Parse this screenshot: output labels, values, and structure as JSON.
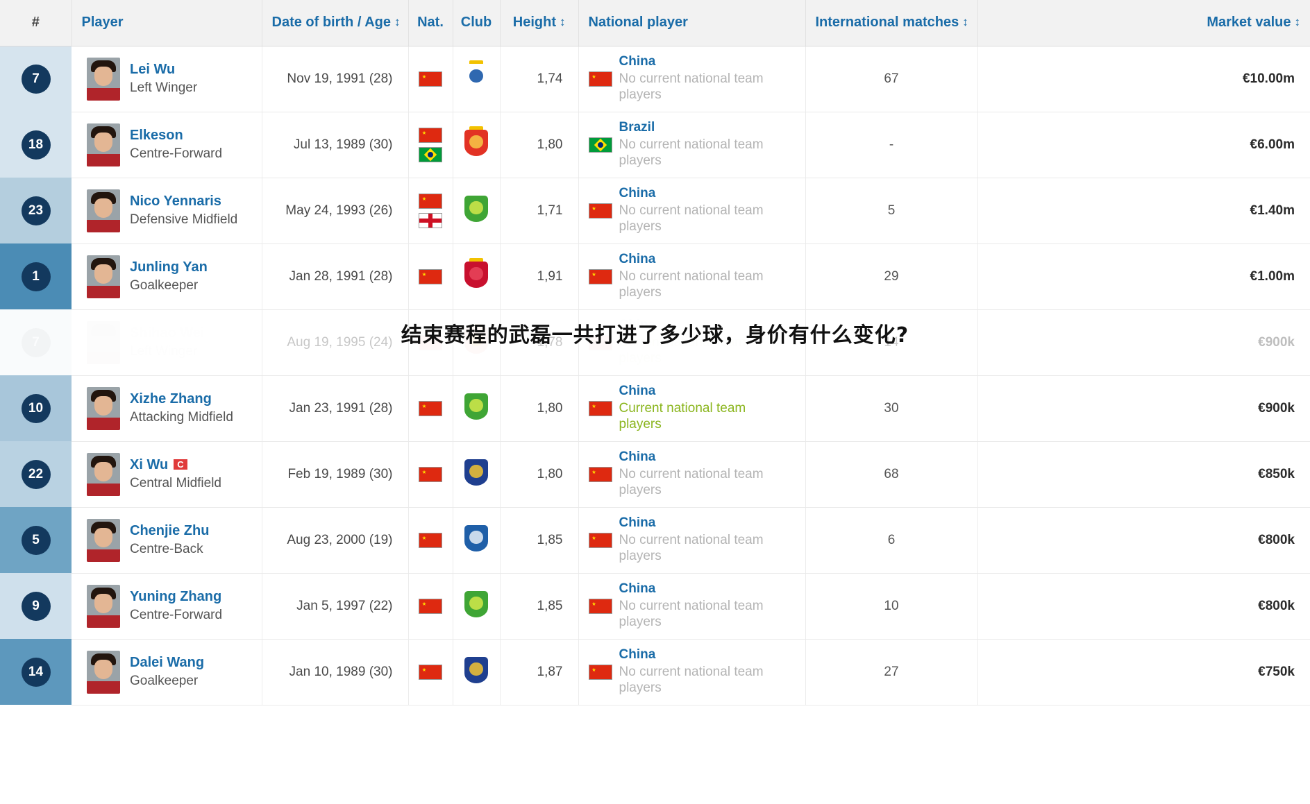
{
  "table": {
    "columns": [
      {
        "key": "rank",
        "label": "#",
        "sortable": false
      },
      {
        "key": "player",
        "label": "Player",
        "sortable": false
      },
      {
        "key": "dob",
        "label": "Date of birth / Age",
        "sortable": true,
        "sort_icon": "sort-updown-icon"
      },
      {
        "key": "nat",
        "label": "Nat.",
        "sortable": false
      },
      {
        "key": "club",
        "label": "Club",
        "sortable": false
      },
      {
        "key": "height",
        "label": "Height",
        "sortable": true,
        "sort_icon": "sort-updown-icon"
      },
      {
        "key": "natpl",
        "label": "National player",
        "sortable": false
      },
      {
        "key": "intl",
        "label": "International matches",
        "sortable": true,
        "sort_icon": "sort-updown-icon"
      },
      {
        "key": "mv",
        "label": "Market value",
        "sortable": true,
        "sort_icon": "sort-updown-icon"
      }
    ],
    "sort_glyph": "↕",
    "rows": [
      {
        "rank": "7",
        "name": "Lei Wu",
        "position": "Left Winger",
        "captain": false,
        "dob": "Nov 19, 1991 (28)",
        "nationalities": [
          "china",
          "none"
        ],
        "club": "espanyol",
        "height": "1,74",
        "nat_country": "China",
        "nat_status": "No current national team players",
        "nat_current": false,
        "intl": "67",
        "market_value": "€10.00m",
        "rank_bg": "#d6e4ee",
        "faded": false
      },
      {
        "rank": "18",
        "name": "Elkeson",
        "position": "Centre-Forward",
        "captain": false,
        "dob": "Jul 13, 1989 (30)",
        "nationalities": [
          "china",
          "brazil"
        ],
        "club": "guangzhou-evergrande",
        "height": "1,80",
        "nat_country": "Brazil",
        "nat_status": "No current national team players",
        "nat_current": false,
        "intl": "-",
        "market_value": "€6.00m",
        "rank_bg": "#d6e4ee",
        "faded": false
      },
      {
        "rank": "23",
        "name": "Nico Yennaris",
        "position": "Defensive Midfield",
        "captain": false,
        "dob": "May 24, 1993 (26)",
        "nationalities": [
          "china",
          "england"
        ],
        "club": "beijing-guoan",
        "height": "1,71",
        "nat_country": "China",
        "nat_status": "No current national team players",
        "nat_current": false,
        "intl": "5",
        "market_value": "€1.40m",
        "rank_bg": "#b4cede",
        "faded": false
      },
      {
        "rank": "1",
        "name": "Junling Yan",
        "position": "Goalkeeper",
        "captain": false,
        "dob": "Jan 28, 1991 (28)",
        "nationalities": [
          "china",
          "none"
        ],
        "club": "shanghai-sipg",
        "height": "1,91",
        "nat_country": "China",
        "nat_status": "No current national team players",
        "nat_current": false,
        "intl": "29",
        "market_value": "€1.00m",
        "rank_bg": "#4b8cb5",
        "faded": false
      },
      {
        "rank": "7",
        "name": "Shihao Wei",
        "position": "Left Winger",
        "captain": false,
        "dob": "Aug 19, 1995 (24)",
        "nationalities": [
          "china",
          "none"
        ],
        "club": "guangzhou-evergrande",
        "height": "1,78",
        "nat_country": "China",
        "nat_status": "Current national team players",
        "nat_current": true,
        "intl": "14",
        "market_value": "€900k",
        "rank_bg": "#eef3f7",
        "faded": true
      },
      {
        "rank": "10",
        "name": "Xizhe Zhang",
        "position": "Attacking Midfield",
        "captain": false,
        "dob": "Jan 23, 1991 (28)",
        "nationalities": [
          "china",
          "none"
        ],
        "club": "beijing-guoan",
        "height": "1,80",
        "nat_country": "China",
        "nat_status": "Current national team players",
        "nat_current": true,
        "intl": "30",
        "market_value": "€900k",
        "rank_bg": "#a8c6da",
        "faded": false
      },
      {
        "rank": "22",
        "name": "Xi Wu",
        "position": "Central Midfield",
        "captain": true,
        "dob": "Feb 19, 1989 (30)",
        "nationalities": [
          "china",
          "none"
        ],
        "club": "shandong-luneng",
        "height": "1,80",
        "nat_country": "China",
        "nat_status": "No current national team players",
        "nat_current": false,
        "intl": "68",
        "market_value": "€850k",
        "rank_bg": "#b9d2e2",
        "faded": false
      },
      {
        "rank": "5",
        "name": "Chenjie Zhu",
        "position": "Centre-Back",
        "captain": false,
        "dob": "Aug 23, 2000 (19)",
        "nationalities": [
          "china",
          "none"
        ],
        "club": "shanghai-shenhua",
        "height": "1,85",
        "nat_country": "China",
        "nat_status": "No current national team players",
        "nat_current": false,
        "intl": "6",
        "market_value": "€800k",
        "rank_bg": "#6fa4c4",
        "faded": false
      },
      {
        "rank": "9",
        "name": "Yuning Zhang",
        "position": "Centre-Forward",
        "captain": false,
        "dob": "Jan 5, 1997 (22)",
        "nationalities": [
          "china",
          "none"
        ],
        "club": "beijing-guoan",
        "height": "1,85",
        "nat_country": "China",
        "nat_status": "No current national team players",
        "nat_current": false,
        "intl": "10",
        "market_value": "€800k",
        "rank_bg": "#cfe0ec",
        "faded": false
      },
      {
        "rank": "14",
        "name": "Dalei Wang",
        "position": "Goalkeeper",
        "captain": false,
        "dob": "Jan 10, 1989 (30)",
        "nationalities": [
          "china",
          "none"
        ],
        "club": "shandong-luneng",
        "height": "1,87",
        "nat_country": "China",
        "nat_status": "No current national team players",
        "nat_current": false,
        "intl": "27",
        "market_value": "€750k",
        "rank_bg": "#5d98bd",
        "faded": false
      }
    ]
  },
  "overlay": {
    "question": "结束赛程的武磊一共打进了多少球，身价有什么变化?"
  },
  "colors": {
    "header_text": "#1a6ca8",
    "link": "#1a6ca8",
    "rank_badge": "#13395e",
    "status_muted": "#b4b4b4",
    "status_current": "#8ab51d",
    "header_bg": "#f2f2f2"
  },
  "club_colors": {
    "espanyol": {
      "shield": "#ffffff",
      "inner": "#0b4ea2",
      "crown": true
    },
    "guangzhou-evergrande": {
      "shield": "#e23224",
      "inner": "#f7c948",
      "crown": true
    },
    "beijing-guoan": {
      "shield": "#3fa535",
      "inner": "#d2e84a",
      "crown": false
    },
    "shanghai-sipg": {
      "shield": "#c8102e",
      "inner": "#e8455a",
      "crown": true
    },
    "shandong-luneng": {
      "shield": "#1f3f8f",
      "inner": "#f3c431",
      "crown": false
    },
    "shanghai-shenhua": {
      "shield": "#1f5fa8",
      "inner": "#e8eef7",
      "crown": false
    }
  }
}
